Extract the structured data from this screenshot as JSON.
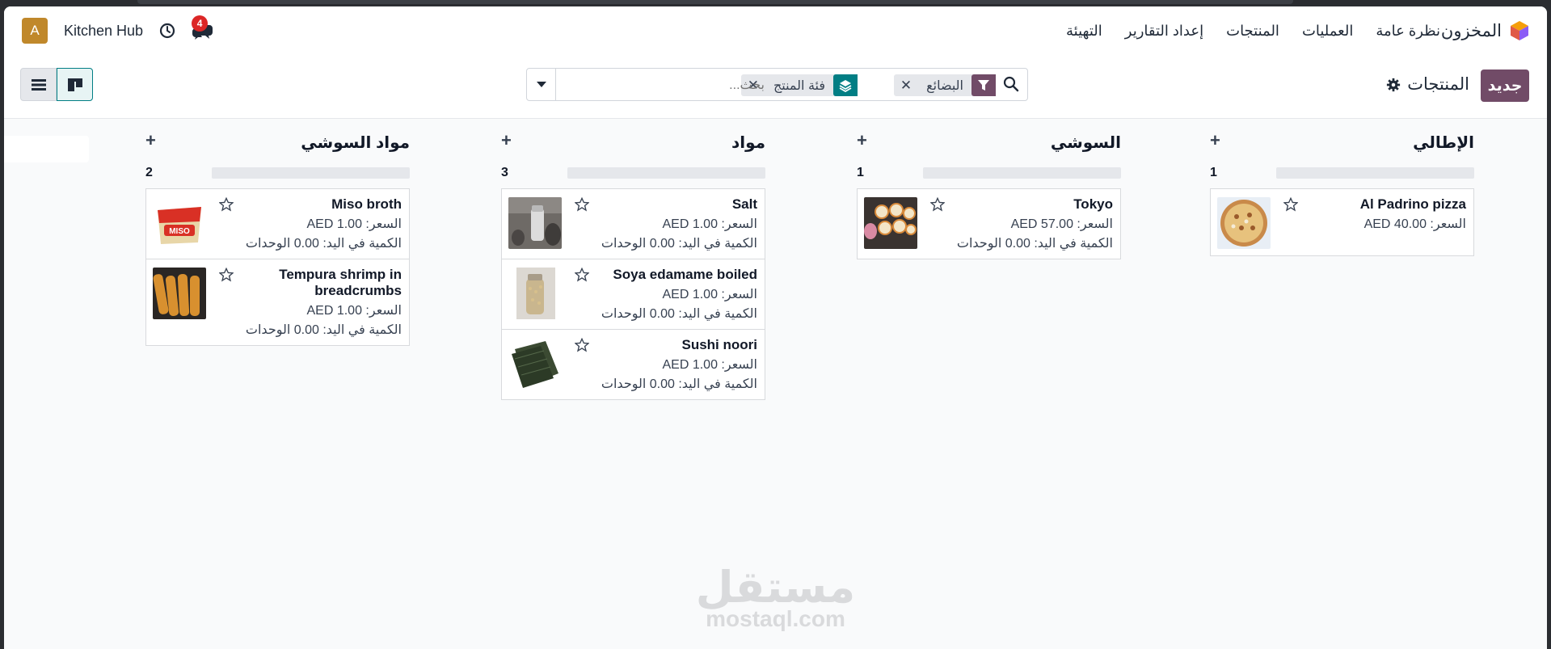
{
  "navbar": {
    "app_name": "المخزون",
    "menu": [
      "نظرة عامة",
      "العمليات",
      "المنتجات",
      "إعداد التقارير",
      "التهيئة"
    ],
    "user_initial": "A",
    "company": "Kitchen Hub",
    "chat_badge": "4",
    "icons": {
      "brand": "inventory-cube-icon",
      "activity": "clock-icon",
      "chat": "messages-icon"
    }
  },
  "control": {
    "new_label": "جديد",
    "breadcrumb": "المنتجات",
    "search": {
      "placeholder": "بحث...",
      "facets": [
        {
          "icon": "filter-icon",
          "label": "البضائع"
        },
        {
          "icon": "group-by-icon",
          "label": "فئة المنتج"
        }
      ]
    },
    "views": [
      "list-view-icon",
      "kanban-view-icon"
    ],
    "active_view": "kanban"
  },
  "columns": [
    {
      "title": "الإطالي",
      "count": "1",
      "cards": [
        {
          "name": "Al Padrino pizza",
          "price": "السعر: 40.00 AED",
          "qty": "",
          "image": "pizza"
        }
      ]
    },
    {
      "title": "السوشي",
      "count": "1",
      "cards": [
        {
          "name": "Tokyo",
          "price": "السعر: 57.00 AED",
          "qty": "الكمية في اليد: 0.00 الوحدات",
          "image": "sushi"
        }
      ]
    },
    {
      "title": "مواد",
      "count": "3",
      "cards": [
        {
          "name": "Salt",
          "price": "السعر: 1.00 AED",
          "qty": "الكمية في اليد: 0.00 الوحدات",
          "image": "salt"
        },
        {
          "name": "Soya edamame boiled",
          "price": "السعر: 1.00 AED",
          "qty": "الكمية في اليد: 0.00 الوحدات",
          "image": "soy"
        },
        {
          "name": "Sushi noori",
          "price": "السعر: 1.00 AED",
          "qty": "الكمية في اليد: 0.00 الوحدات",
          "image": "noori"
        }
      ]
    },
    {
      "title": "مواد السوشي",
      "count": "2",
      "cards": [
        {
          "name": "Miso broth",
          "price": "السعر: 1.00 AED",
          "qty": "الكمية في اليد: 0.00 الوحدات",
          "image": "miso"
        },
        {
          "name": "Tempura shrimp in breadcrumbs",
          "price": "السعر: 1.00 AED",
          "qty": "الكمية في اليد: 0.00 الوحدات",
          "image": "tempura"
        }
      ]
    }
  ],
  "watermark": {
    "ar": "مستقل",
    "en": "mostaql.com"
  },
  "colors": {
    "primary": "#714b67",
    "accent": "#017e84",
    "badge": "#dc2626",
    "avatar": "#c0882b"
  }
}
